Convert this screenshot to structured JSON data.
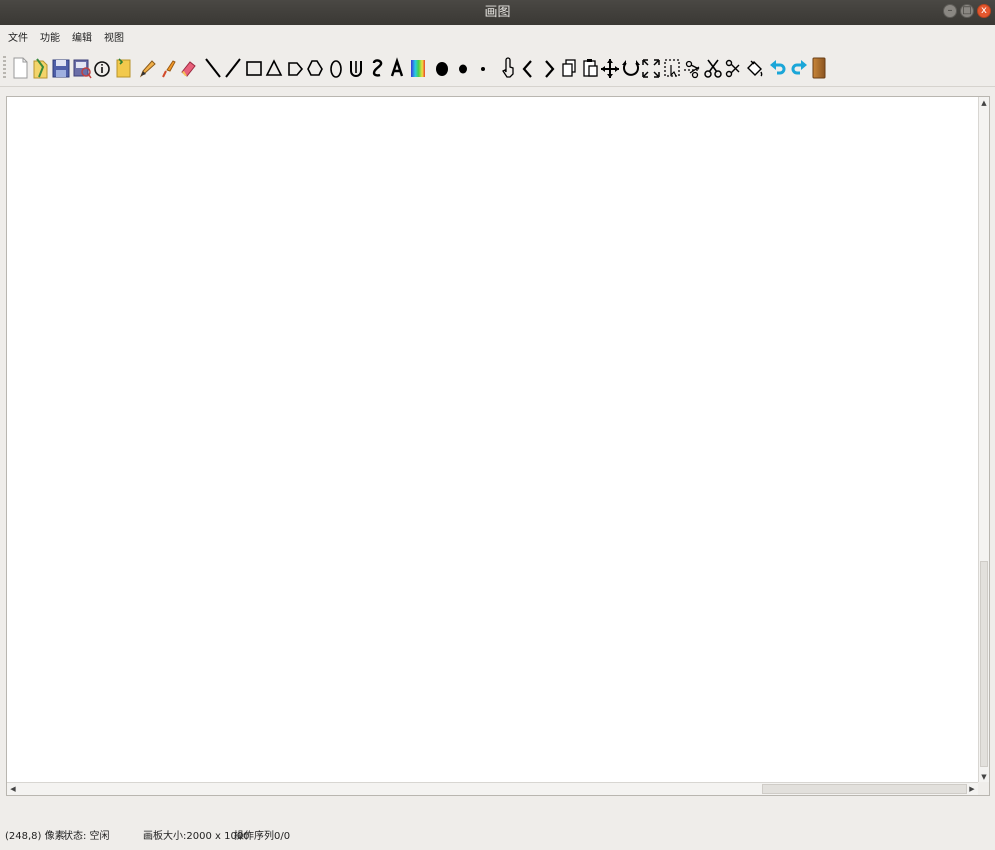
{
  "window": {
    "title": "画图",
    "buttons": {
      "minimize": "–",
      "maximize": "□",
      "close": "x"
    }
  },
  "menu": [
    "文件",
    "功能",
    "编辑",
    "视图"
  ],
  "toolbar": {
    "tools": [
      "new-file-icon",
      "open-file-icon",
      "save-icon",
      "save-as-icon",
      "info-icon",
      "paste-clipboard-icon",
      "pencil-icon",
      "brush-icon",
      "eraser-icon",
      "line-backslash-icon",
      "line-slash-icon",
      "rectangle-icon",
      "triangle-icon",
      "pentagon-icon",
      "hexagon-icon",
      "ellipse-icon",
      "curve-u-icon",
      "curve-s-icon",
      "text-icon",
      "color-gradient-icon",
      "pen-size-large-icon",
      "pen-size-medium-icon",
      "pen-size-small-icon",
      "hand-pointer-icon",
      "arrow-left-icon",
      "arrow-right-icon",
      "copy-icon",
      "paste-icon",
      "move-icon",
      "rotate-icon",
      "fullscreen-icon",
      "select-icon",
      "crop-scissors-icon",
      "cut-icon",
      "scissors-icon",
      "fill-bucket-icon",
      "undo-icon",
      "redo-icon",
      "board-icon"
    ]
  },
  "scroll": {
    "up": "▲",
    "down": "▼",
    "left": "◀",
    "right": "▶"
  },
  "status": {
    "coords": "(248,8) 像素",
    "state": "状态: 空闲",
    "canvas_size": "画板大小:2000 x 1000",
    "ops": "操作序列0/0"
  },
  "colors": {
    "title_bg": "#3e3c38",
    "window_bg": "#efedea",
    "close_btn": "#e4572e",
    "accent_blue": "#1aa6d8"
  }
}
